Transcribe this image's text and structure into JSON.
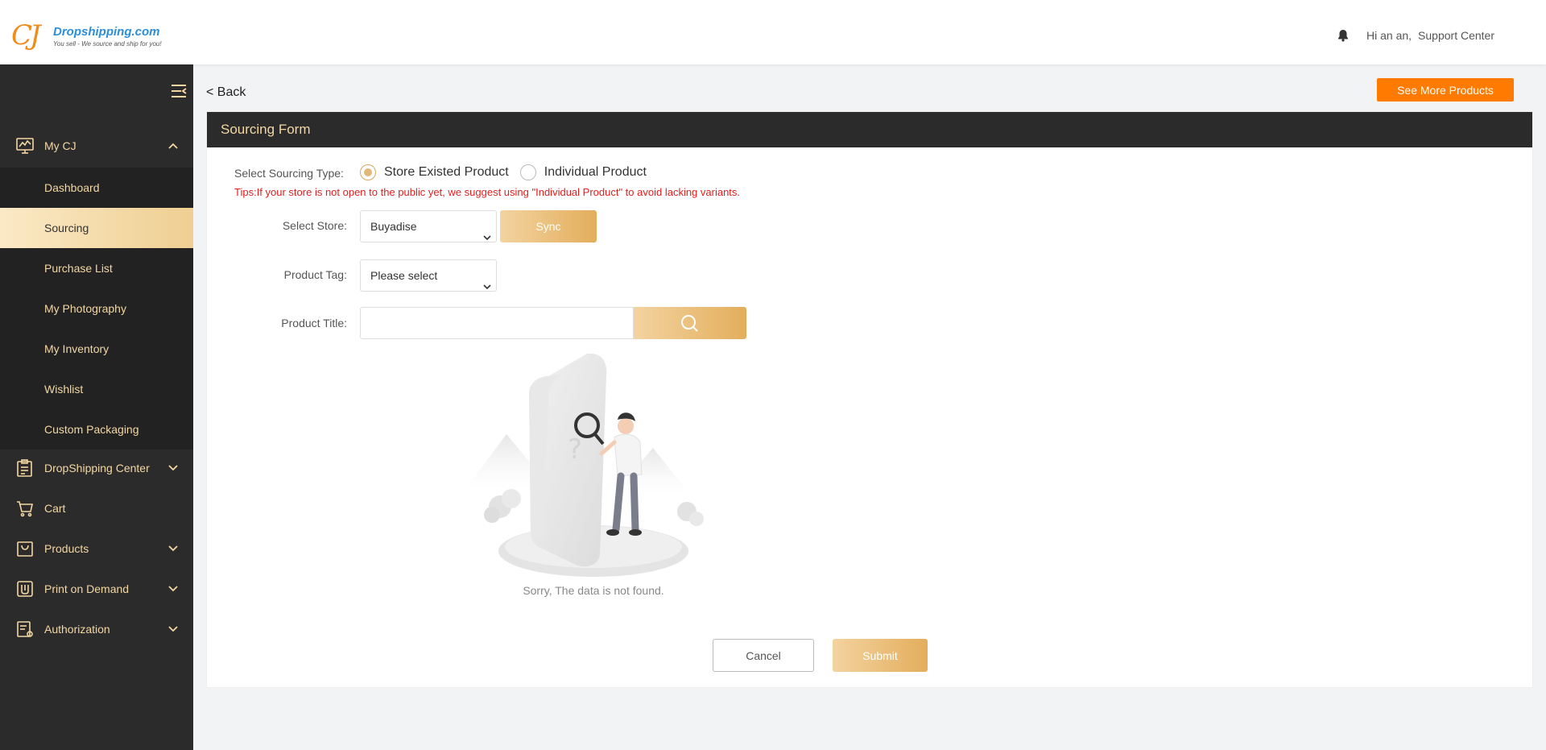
{
  "header": {
    "logo_mark": "CJ",
    "logo_name": "Dropshipping.com",
    "logo_tagline": "You sell - We source and ship for you!",
    "greeting": "Hi an an,",
    "support_link": "Support Center"
  },
  "sidebar": {
    "groups": {
      "my_cj": {
        "label": "My CJ",
        "icon": "monitor-chart-icon",
        "expanded": true
      },
      "dropshipping_center": {
        "label": "DropShipping Center",
        "icon": "clipboard-icon"
      },
      "cart": {
        "label": "Cart",
        "icon": "cart-icon"
      },
      "products": {
        "label": "Products",
        "icon": "bag-icon"
      },
      "print_on_demand": {
        "label": "Print on Demand",
        "icon": "print-icon"
      },
      "authorization": {
        "label": "Authorization",
        "icon": "doc-gear-icon"
      }
    },
    "my_cj_items": [
      "Dashboard",
      "Sourcing",
      "Purchase List",
      "My Photography",
      "My Inventory",
      "Wishlist",
      "Custom Packaging"
    ],
    "active_item": "Sourcing"
  },
  "page": {
    "back_label": "< Back",
    "see_more_label": "See More Products",
    "form_title": "Sourcing Form",
    "sourcing_type_label": "Select Sourcing Type:",
    "radio_options": [
      "Store Existed Product",
      "Individual Product"
    ],
    "radio_selected": "Store Existed Product",
    "tips": "Tips:If your store is not open to the public yet, we suggest using \"Individual Product\" to avoid lacking variants.",
    "store_label": "Select Store:",
    "store_value": "Buyadise",
    "sync_label": "Sync",
    "tag_label": "Product Tag:",
    "tag_value": "Please select",
    "title_label": "Product Title:",
    "title_value": "",
    "empty_text": "Sorry, The data is not found.",
    "cancel_label": "Cancel",
    "submit_label": "Submit"
  },
  "colors": {
    "accent_orange": "#ff7a00",
    "gold_light": "#f3d3a0",
    "gold_dark": "#e3ae5c",
    "sidebar_bg": "#2b2b2b",
    "sidebar_text": "#f3d7a3",
    "tips_red": "#e02020"
  }
}
